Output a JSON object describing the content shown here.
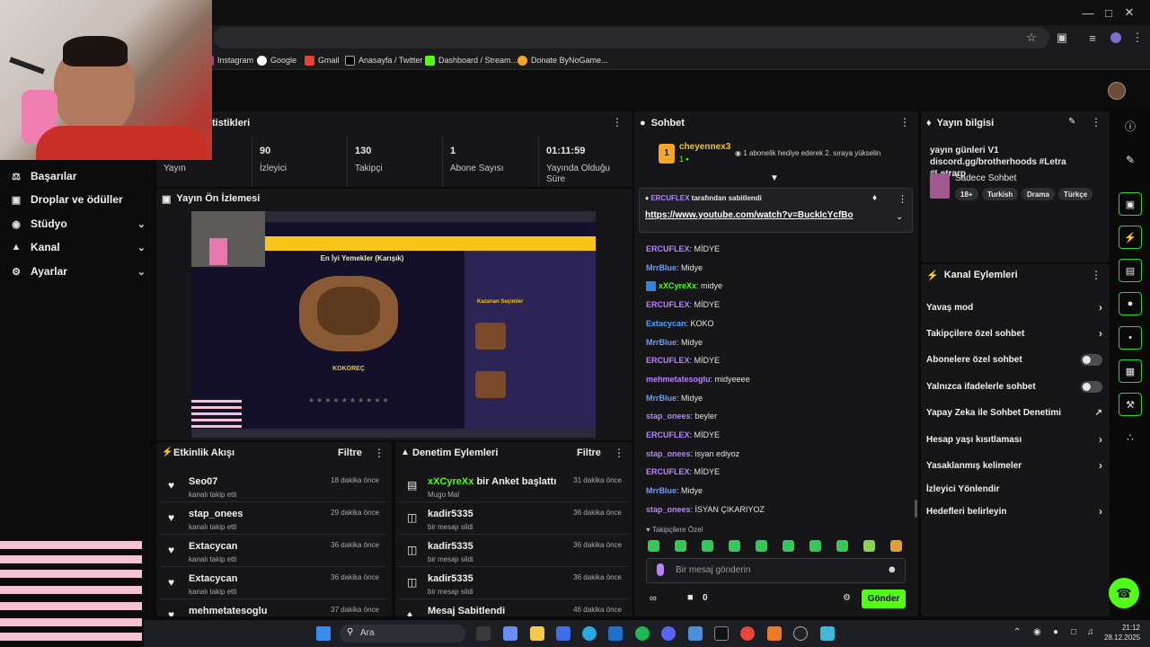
{
  "colors": {
    "accent": "#53fc18",
    "chat_purple": "#b784ff",
    "chat_blue": "#6c9cff",
    "chat_green": "#53fc18",
    "pink_overlay": "#f4c3d2"
  },
  "bookmarks": [
    {
      "label": "Instagram",
      "icon": "instagram-icon"
    },
    {
      "label": "Google",
      "icon": "google-icon"
    },
    {
      "label": "Gmail",
      "icon": "gmail-icon"
    },
    {
      "label": "Anasayfa / Twitter",
      "icon": "x-icon"
    },
    {
      "label": "Dashboard / Stream...",
      "icon": "kick-icon"
    },
    {
      "label": "Donate ByNoGame...",
      "icon": "bynogame-icon"
    }
  ],
  "nav": {
    "items": [
      {
        "label": "Başarılar",
        "icon": "trophy-icon",
        "chevron": false
      },
      {
        "label": "Droplar ve ödüller",
        "icon": "gift-icon",
        "chevron": false
      },
      {
        "label": "Stüdyo",
        "icon": "studio-icon",
        "chevron": true
      },
      {
        "label": "Kanal",
        "icon": "megaphone-icon",
        "chevron": true
      },
      {
        "label": "Ayarlar",
        "icon": "gear-icon",
        "chevron": true
      }
    ]
  },
  "stats": {
    "header": "tistikleri",
    "items": [
      {
        "value": "",
        "label": "Yayın"
      },
      {
        "value": "90",
        "label": "İzleyici"
      },
      {
        "value": "130",
        "label": "Takipçi"
      },
      {
        "value": "1",
        "label": "Abone Sayısı"
      },
      {
        "value": "01:11:59",
        "label": "Yayında Olduğu Süre"
      }
    ]
  },
  "preview": {
    "title": "Yayın Ön İzlemesi",
    "inner_heading": "En İyi Yemekler (Karışık)",
    "inner_item": "KOKOREÇ",
    "inner_side": "Kazanan Seçimler"
  },
  "activity": {
    "title": "Etkinlik Akışı",
    "filter": "Filtre",
    "rows": [
      {
        "name": "Seo07",
        "sub": "kanalı takip etti",
        "time": "18 dakika önce"
      },
      {
        "name": "stap_onees",
        "sub": "kanalı takip etti",
        "time": "29 dakika önce"
      },
      {
        "name": "Extacycan",
        "sub": "kanalı takip etti",
        "time": "36 dakika önce"
      },
      {
        "name": "Extacycan",
        "sub": "kanalı takip etti",
        "time": "36 dakika önce"
      },
      {
        "name": "mehmetatesoglu",
        "sub": "",
        "time": "37 dakika önce"
      }
    ]
  },
  "moderation": {
    "title": "Denetim Eylemleri",
    "filter": "Filtre",
    "rows": [
      {
        "name": "xXCyreXx",
        "action": "bir Anket başlattı",
        "sub": "Mugo Mal",
        "time": "31 dakika önce",
        "icon": "poll-icon"
      },
      {
        "name": "kadir5335",
        "action": "",
        "sub": "bir mesajı sildi",
        "time": "36 dakika önce",
        "icon": "trash-icon"
      },
      {
        "name": "kadir5335",
        "action": "",
        "sub": "bir mesajı sildi",
        "time": "36 dakika önce",
        "icon": "trash-icon"
      },
      {
        "name": "kadir5335",
        "action": "",
        "sub": "bir mesajı sildi",
        "time": "36 dakika önce",
        "icon": "trash-icon"
      },
      {
        "name": "Mesaj Sabitlendi",
        "action": "",
        "sub": "",
        "time": "46 dakika önce",
        "icon": "pin-icon"
      }
    ]
  },
  "chat": {
    "title": "Sohbet",
    "gift_user": "cheyennex3",
    "gift_count": "1",
    "gift_text": "1 abonelik hediye ederek 2. sıraya yükselin",
    "pinned_by": "ERCUFLEX",
    "pinned_suffix": "tarafından sabitlendi",
    "pinned_link": "https://www.youtube.com/watch?v=BuckIcYcfBo",
    "messages": [
      {
        "user": "ERCUFLEX",
        "text": "MİDYE",
        "color": "#b784ff"
      },
      {
        "user": "MrrBlue",
        "text": "Midye",
        "color": "#6c9cff"
      },
      {
        "user": "xXCyreXx",
        "text": "midye",
        "color": "#53fc18"
      },
      {
        "user": "ERCUFLEX",
        "text": "MİDYE",
        "color": "#b784ff"
      },
      {
        "user": "Extacycan",
        "text": "KOKO",
        "color": "#4da3ff"
      },
      {
        "user": "MrrBlue",
        "text": "Midye",
        "color": "#6c9cff"
      },
      {
        "user": "ERCUFLEX",
        "text": "MİDYE",
        "color": "#b784ff"
      },
      {
        "user": "mehmetatesoglu",
        "text": "midyeeee",
        "color": "#b784ff"
      },
      {
        "user": "MrrBlue",
        "text": "Midye",
        "color": "#6c9cff"
      },
      {
        "user": "stap_onees",
        "text": "beyler",
        "color": "#b784ff"
      },
      {
        "user": "ERCUFLEX",
        "text": "MİDYE",
        "color": "#b784ff"
      },
      {
        "user": "stap_onees",
        "text": "isyan ediyoz",
        "color": "#b784ff"
      },
      {
        "user": "ERCUFLEX",
        "text": "MİDYE",
        "color": "#b784ff"
      },
      {
        "user": "MrrBlue",
        "text": "Midye",
        "color": "#6c9cff"
      },
      {
        "user": "stap_onees",
        "text": "İSYAN ÇIKARIYOZ",
        "color": "#b784ff"
      }
    ],
    "followers_only": "Takipçilere Özel",
    "placeholder": "Bir mesaj gönderin",
    "count": "0",
    "send": "Gönder"
  },
  "stream_info": {
    "title": "Yayın bilgisi",
    "stream_title": "yayın günleri V1 discord.gg/brotherhoods #Letra #Letrarp",
    "category": "Sadece Sohbet",
    "tags": [
      "18+",
      "Turkish",
      "Drama",
      "Türkçe"
    ]
  },
  "channel_actions": {
    "title": "Kanal Eylemleri",
    "items": [
      {
        "label": "Yavaş mod",
        "control": "chevron"
      },
      {
        "label": "Takipçilere özel sohbet",
        "control": "chevron"
      },
      {
        "label": "Abonelere özel sohbet",
        "control": "toggle"
      },
      {
        "label": "Yalnızca ifadelerle sohbet",
        "control": "toggle"
      },
      {
        "label": "Yapay Zeka ile Sohbet Denetimi",
        "control": "external"
      },
      {
        "label": "Hesap yaşı kısıtlaması",
        "control": "chevron"
      },
      {
        "label": "Yasaklanmış kelimeler",
        "control": "chevron"
      },
      {
        "label": "İzleyici Yönlendir",
        "control": "none"
      },
      {
        "label": "Hedefleri belirleyin",
        "control": "chevron"
      }
    ]
  },
  "taskbar": {
    "search": "Ara",
    "time": "21:12",
    "date": "28.12.2025"
  }
}
